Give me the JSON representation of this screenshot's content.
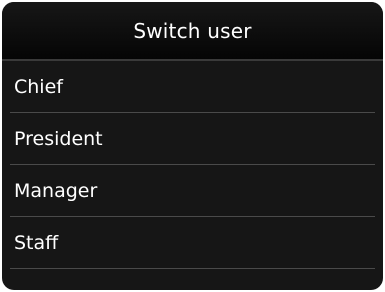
{
  "screen": {
    "title": "Switch user"
  },
  "users": [
    {
      "label": "Chief"
    },
    {
      "label": "President"
    },
    {
      "label": "Manager"
    },
    {
      "label": "Staff"
    }
  ],
  "colors": {
    "background": "#161616",
    "title_bar": "#0a0a0a",
    "text": "#ffffff",
    "divider": "#4a4a4a"
  }
}
